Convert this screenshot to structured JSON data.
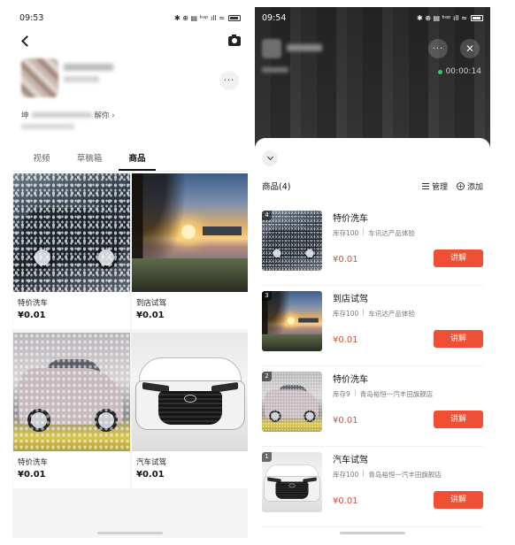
{
  "left": {
    "status_time": "09:53",
    "status_icons_text": "✱ ⊕ ▤ ᵇᵃᵖ ıll ≈",
    "bio_prefix": "坤",
    "bio_suffix": "解你 ›",
    "more_label": "···",
    "tabs": [
      {
        "label": "视频",
        "active": false
      },
      {
        "label": "草稿箱",
        "active": false
      },
      {
        "label": "商品",
        "active": true
      }
    ],
    "products": [
      {
        "title": "特价洗车",
        "price": "¥0.01",
        "image": "car-wash-foam"
      },
      {
        "title": "到店试驾",
        "price": "¥0.01",
        "image": "lake-sunset"
      },
      {
        "title": "特价洗车",
        "price": "¥0.01",
        "image": "car-wash-garage"
      },
      {
        "title": "汽车试驾",
        "price": "¥0.01",
        "image": "toyota-front"
      }
    ]
  },
  "right": {
    "status_time": "09:54",
    "status_icons_text": "✱ ⊕ ▤ ᵇᵃᵖ ıll ≈",
    "timer": "00:00:14",
    "more_label": "···",
    "close_label": "✕",
    "sheet_title": "商品(4)",
    "manage_label": "管理",
    "add_label": "添加",
    "items": [
      {
        "num": "4",
        "name": "特价洗车",
        "stock": "库存100",
        "shop": "车讯达产品体验",
        "price": "¥0.01",
        "button": "讲解",
        "image": "car-wash-foam"
      },
      {
        "num": "3",
        "name": "到店试驾",
        "stock": "库存100",
        "shop": "车讯达产品体验",
        "price": "¥0.01",
        "button": "讲解",
        "image": "lake-sunset"
      },
      {
        "num": "2",
        "name": "特价洗车",
        "stock": "库存9",
        "shop": "青岛裕恒一汽丰田旗舰店",
        "price": "¥0.01",
        "button": "讲解",
        "image": "car-wash-garage"
      },
      {
        "num": "1",
        "name": "汽车试驾",
        "stock": "库存100",
        "shop": "青岛裕恒一汽丰田旗舰店",
        "price": "¥0.01",
        "button": "讲解",
        "image": "toyota-front"
      }
    ]
  },
  "colors": {
    "accent_button": "#ef4f34",
    "price_red": "#e8492c"
  },
  "icons": [
    "back-chevron-icon",
    "camera-icon",
    "more-icon",
    "close-icon",
    "chevron-down-icon",
    "list-icon",
    "plus-circle-icon",
    "battery-icon"
  ]
}
